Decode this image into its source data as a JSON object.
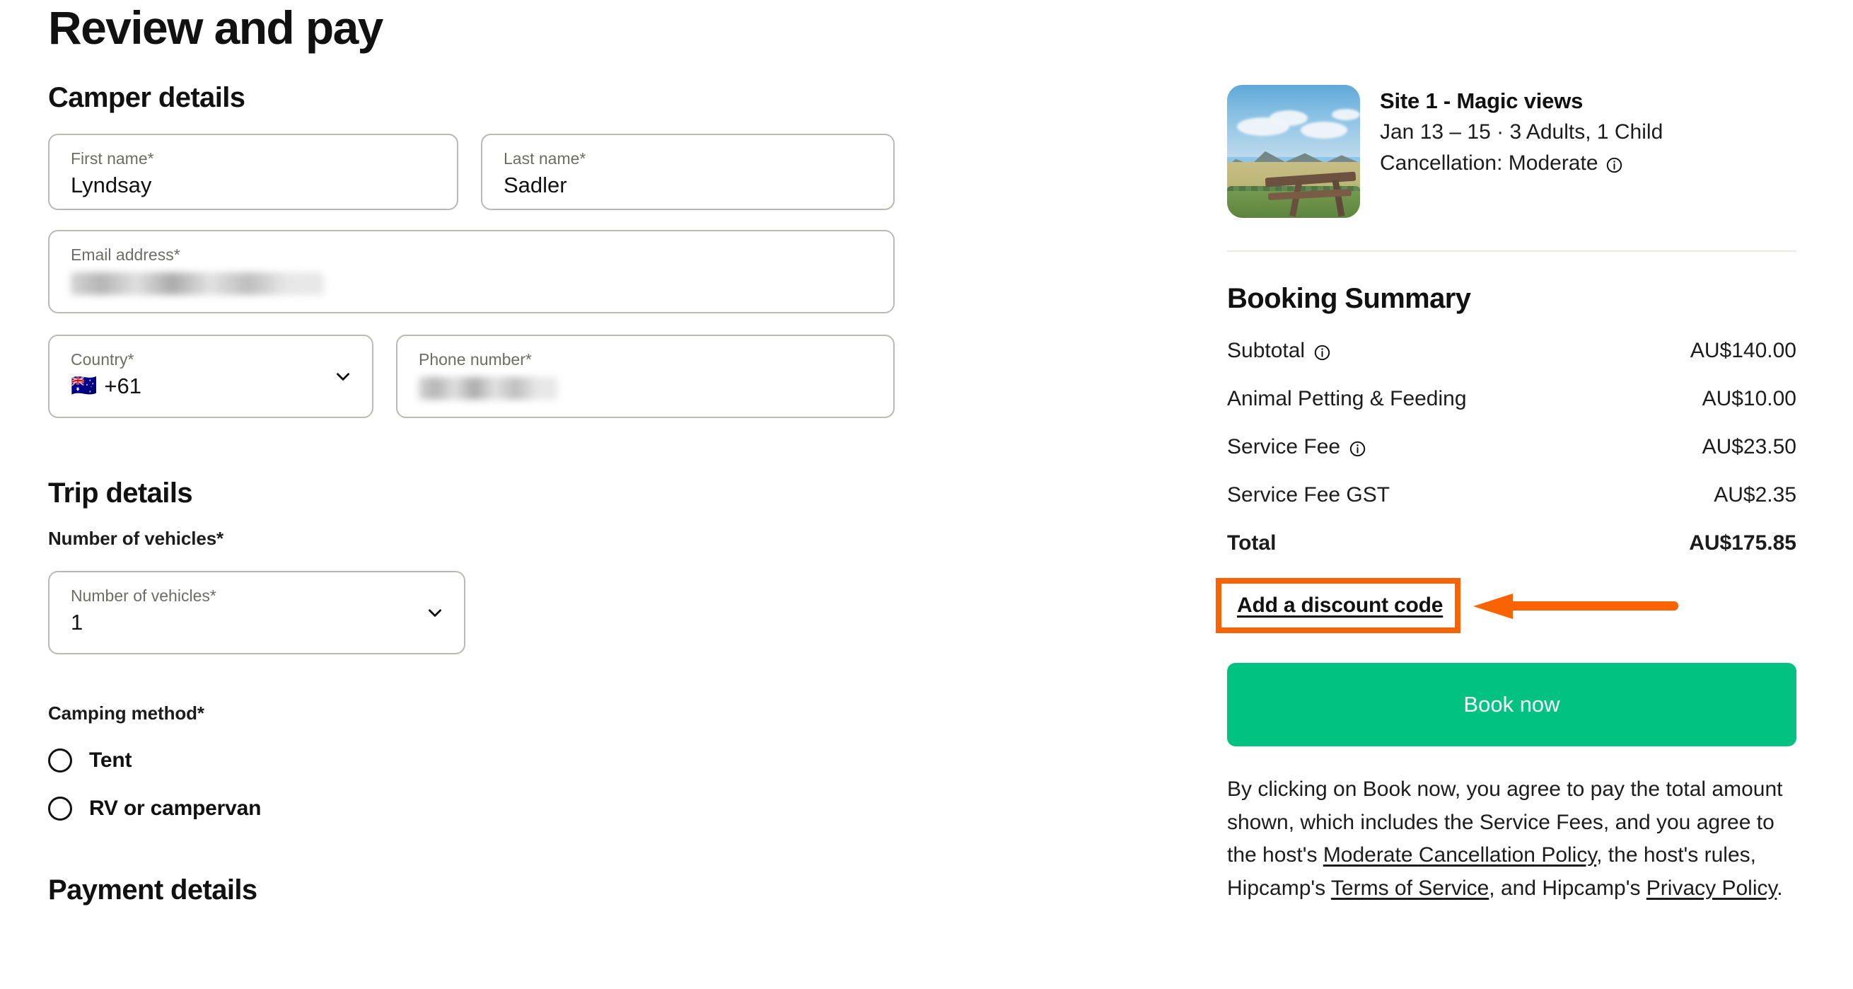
{
  "page": {
    "title": "Review and pay"
  },
  "camper": {
    "section_title": "Camper details",
    "first_name": {
      "label": "First name*",
      "value": "Lyndsay"
    },
    "last_name": {
      "label": "Last name*",
      "value": "Sadler"
    },
    "email": {
      "label": "Email address*",
      "value": ""
    },
    "country": {
      "label": "Country*",
      "value": "+61",
      "flag": "au-flag-icon"
    },
    "phone": {
      "label": "Phone number*",
      "value": ""
    }
  },
  "trip": {
    "section_title": "Trip details",
    "vehicles_heading": "Number of vehicles*",
    "vehicles_select": {
      "label": "Number of vehicles*",
      "value": "1"
    },
    "camping_method_heading": "Camping method*",
    "camping_options": [
      {
        "label": "Tent",
        "selected": false
      },
      {
        "label": "RV or campervan",
        "selected": false
      }
    ]
  },
  "payment": {
    "section_title": "Payment details"
  },
  "summary": {
    "site_name": "Site 1 - Magic views",
    "dates_guests": "Jan 13 – 15 · 3 Adults, 1 Child",
    "cancellation": "Cancellation: Moderate",
    "heading": "Booking Summary",
    "line_items": [
      {
        "label": "Subtotal",
        "amount": "AU$140.00",
        "info": true,
        "bold": false
      },
      {
        "label": "Animal Petting & Feeding",
        "amount": "AU$10.00",
        "info": false,
        "bold": false
      },
      {
        "label": "Service Fee",
        "amount": "AU$23.50",
        "info": true,
        "bold": false
      },
      {
        "label": "Service Fee GST",
        "amount": "AU$2.35",
        "info": false,
        "bold": false
      },
      {
        "label": "Total",
        "amount": "AU$175.85",
        "info": false,
        "bold": true
      }
    ],
    "discount_link": "Add a discount code",
    "book_button": "Book now"
  },
  "terms": {
    "part1": "By clicking on Book now, you agree to pay the total amount shown, which includes the Service Fees, and you agree to the host's ",
    "link1": "Moderate Cancellation Policy",
    "part2": ", the host's rules, Hipcamp's ",
    "link2": "Terms of Service",
    "part3": ", and Hipcamp's ",
    "link3": "Privacy Policy",
    "part4": "."
  },
  "annotation": {
    "highlight_color": "#f96302",
    "arrow_color": "#f96302"
  },
  "colors": {
    "book_button_green": "#02c281",
    "border_grey": "#b9b9b5",
    "label_grey": "#6d6d66"
  }
}
